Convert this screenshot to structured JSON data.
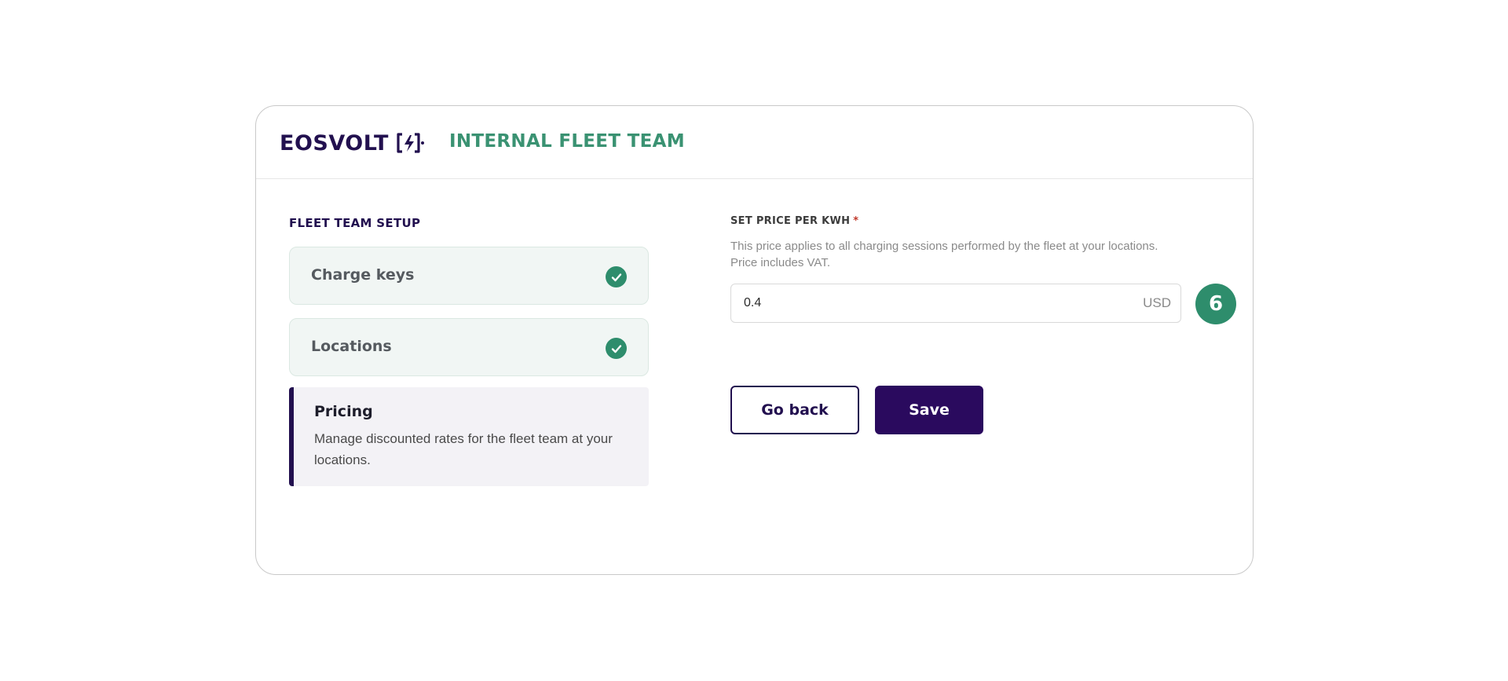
{
  "header": {
    "brand": "EOSVOLT",
    "team_title": "INTERNAL FLEET TEAM"
  },
  "setup": {
    "title": "FLEET TEAM SETUP",
    "steps": [
      {
        "label": "Charge keys",
        "status": "completed"
      },
      {
        "label": "Locations",
        "status": "completed"
      },
      {
        "label": "Pricing",
        "status": "active",
        "description": "Manage discounted rates for the fleet team at your locations."
      }
    ]
  },
  "pricing": {
    "label": "SET PRICE PER KWH",
    "required_mark": "*",
    "help_line1": "This price applies to all charging sessions performed by the fleet at your locations.",
    "help_line2": "Price includes VAT.",
    "value": "0.4",
    "currency": "USD",
    "step_badge": "6"
  },
  "actions": {
    "back_label": "Go back",
    "save_label": "Save"
  },
  "colors": {
    "brand": "#22104f",
    "accent_green": "#2e8d6c",
    "primary_button": "#2a0a5e"
  },
  "icons": {
    "brand_mark": "lightning-bolt-icon",
    "step_complete": "check-circle-icon"
  }
}
